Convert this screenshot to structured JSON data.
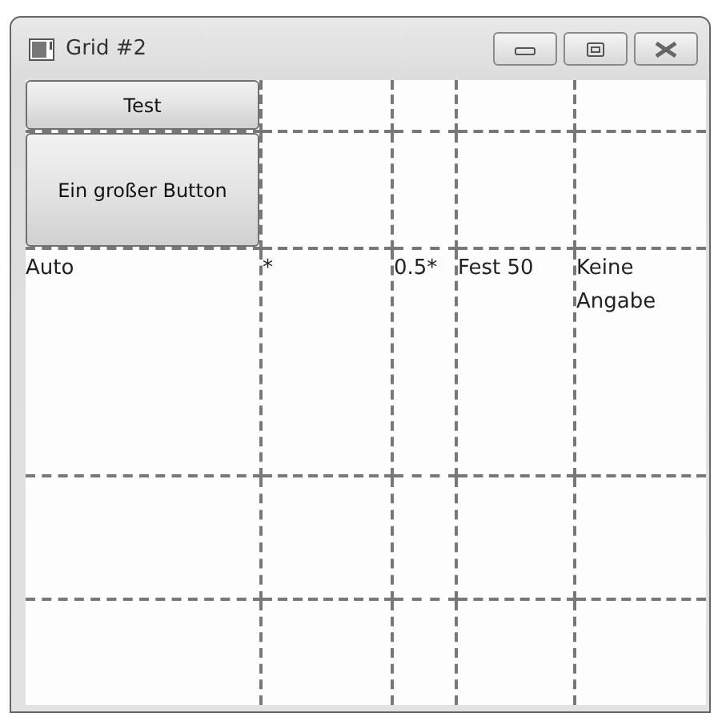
{
  "window": {
    "title": "Grid #2"
  },
  "buttons": [
    {
      "label": "Test"
    },
    {
      "label": "Ein großer Button"
    }
  ],
  "grid": {
    "labels": [
      "Auto",
      "*",
      "0.5*",
      "Fest 50",
      "Keine Angabe"
    ]
  }
}
